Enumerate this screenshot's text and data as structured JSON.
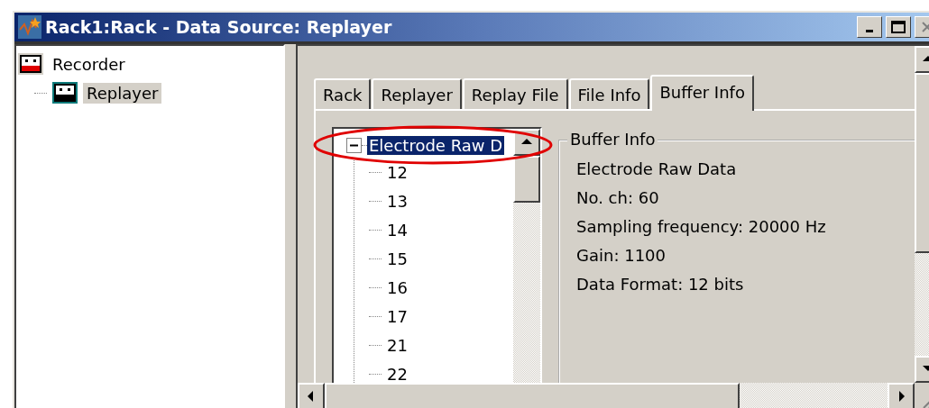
{
  "window": {
    "title": "Rack1:Rack - Data Source: Replayer"
  },
  "source_tree": [
    {
      "label": "Recorder",
      "selected": false,
      "children": [
        {
          "label": "Replayer",
          "selected": true
        }
      ]
    }
  ],
  "tabs": [
    {
      "label": "Rack",
      "selected": false
    },
    {
      "label": "Replayer",
      "selected": false
    },
    {
      "label": "Replay File",
      "selected": false
    },
    {
      "label": "File Info",
      "selected": false
    },
    {
      "label": "Buffer Info",
      "selected": true
    }
  ],
  "buffer_tree": {
    "label": "Electrode Raw D",
    "selected": true,
    "expanded": true,
    "children": [
      {
        "label": "12"
      },
      {
        "label": "13"
      },
      {
        "label": "14"
      },
      {
        "label": "15"
      },
      {
        "label": "16"
      },
      {
        "label": "17"
      },
      {
        "label": "21"
      },
      {
        "label": "22"
      }
    ]
  },
  "buffer_info": {
    "title": "Buffer Info",
    "lines": [
      "Electrode Raw Data",
      "No. ch: 60",
      "Sampling frequency: 20000 Hz",
      "Gain: 1100",
      "Data Format: 12 bits"
    ]
  }
}
